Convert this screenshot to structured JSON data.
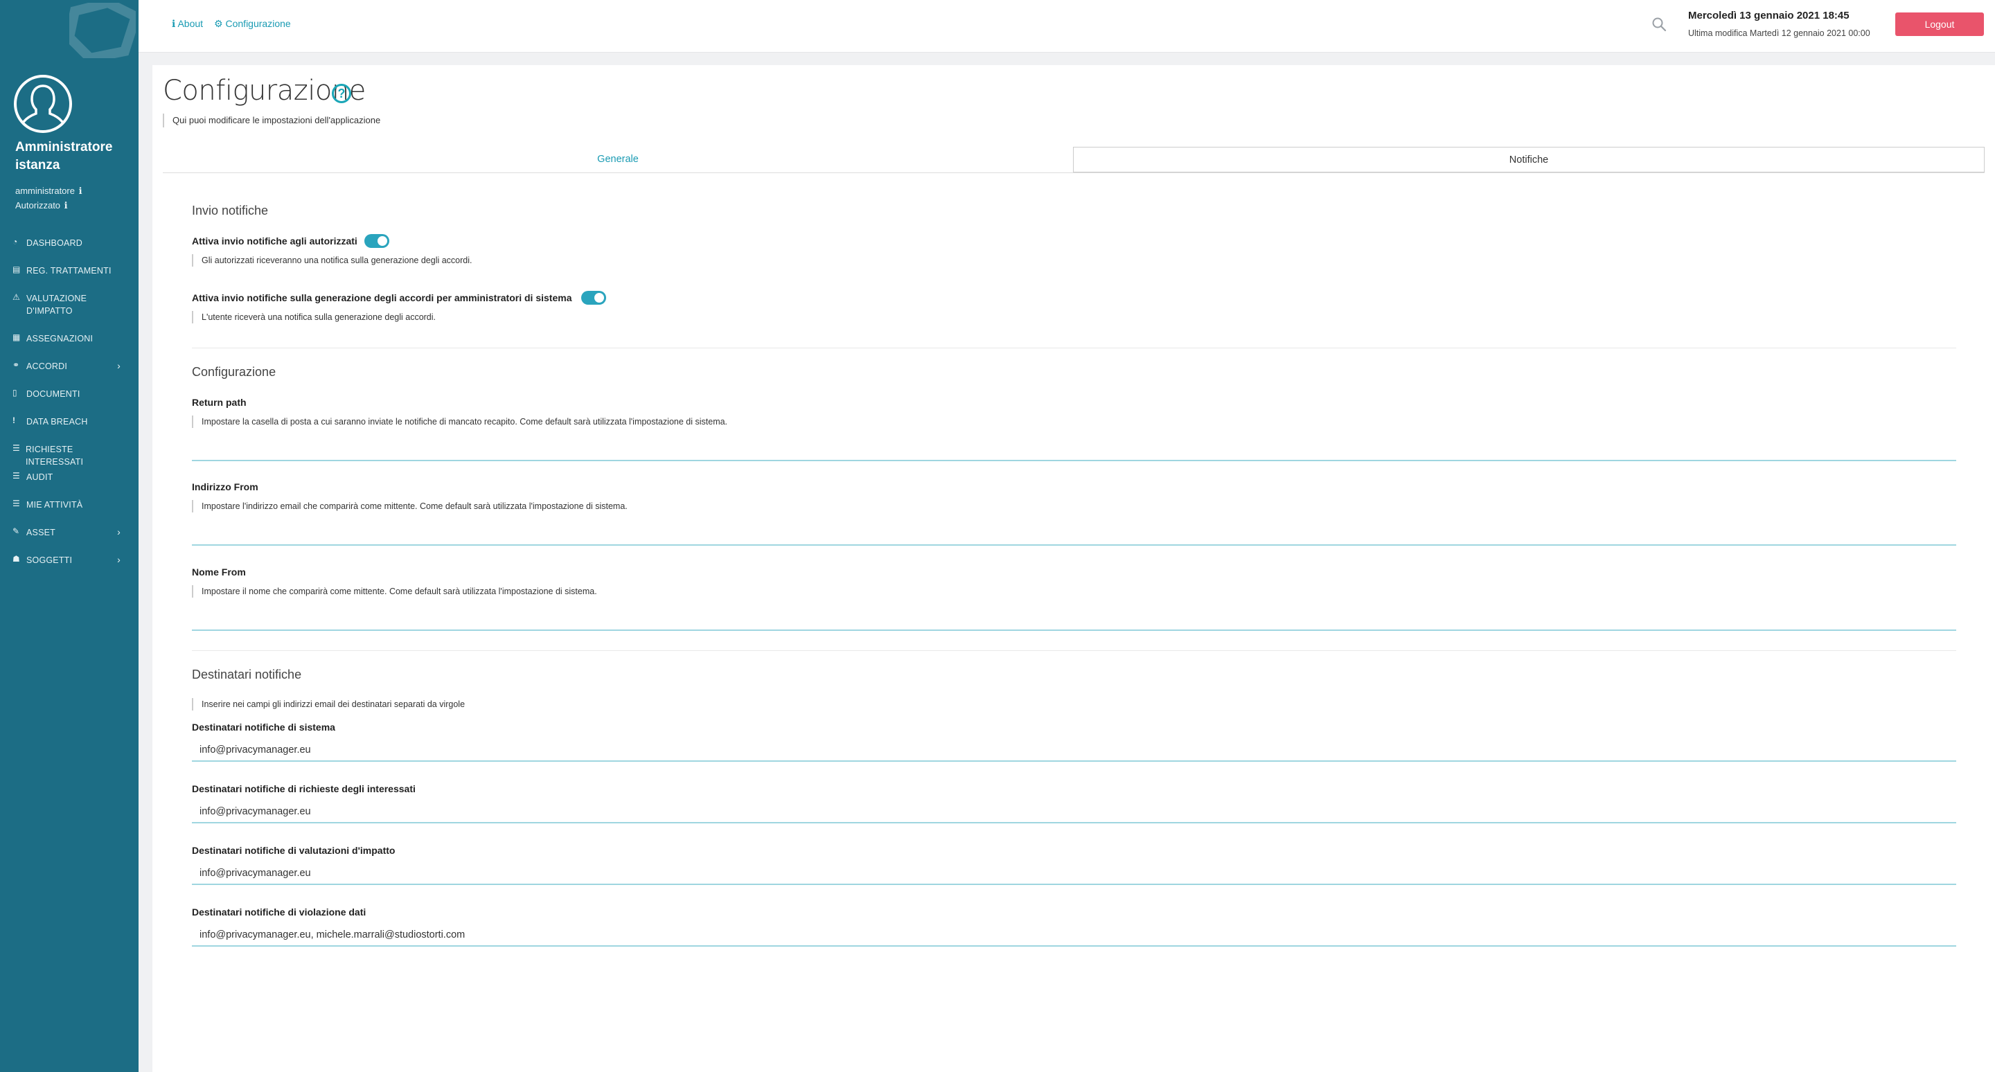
{
  "user": {
    "display_name": "Amministratore istanza",
    "role": "amministratore",
    "status": "Autorizzato",
    "info_glyph": "ℹ"
  },
  "sidebar": {
    "items": [
      {
        "label": "DASHBOARD",
        "icon": "dashboard-icon",
        "glyph": "◔"
      },
      {
        "label": "REG. TRATTAMENTI",
        "icon": "book-icon",
        "glyph": "▤"
      },
      {
        "label": "VALUTAZIONE D'IMPATTO",
        "icon": "warning-icon",
        "glyph": "⚠"
      },
      {
        "label": "ASSEGNAZIONI",
        "icon": "clipboard-icon",
        "glyph": "▦"
      },
      {
        "label": "ACCORDI",
        "icon": "handshake-icon",
        "glyph": "⚭",
        "submenu": true
      },
      {
        "label": "DOCUMENTI",
        "icon": "file-icon",
        "glyph": "▯"
      },
      {
        "label": "DATA BREACH",
        "icon": "exclamation-icon",
        "glyph": "!"
      },
      {
        "label": "RICHIESTE INTERESSATI",
        "icon": "list-icon",
        "glyph": "☰"
      },
      {
        "label": "AUDIT",
        "icon": "list-check-icon",
        "glyph": "☰"
      },
      {
        "label": "MIE ATTIVITÀ",
        "icon": "list-icon",
        "glyph": "☰"
      },
      {
        "label": "ASSET",
        "icon": "edit-icon",
        "glyph": "✎",
        "submenu": true
      },
      {
        "label": "SOGGETTI",
        "icon": "users-icon",
        "glyph": "☗",
        "submenu": true
      }
    ],
    "chevron": "›"
  },
  "topbar": {
    "about_label": "About",
    "about_glyph": "ℹ",
    "config_label": "Configurazione",
    "config_glyph": "⚙",
    "datetime": "Mercoledì 13 gennaio 2021 18:45",
    "last_modified": "Ultima modifica Martedì 12 gennaio 2021 00:00",
    "logout_label": "Logout"
  },
  "page": {
    "title": "Configurazione",
    "help_glyph": "?",
    "subtitle": "Qui puoi modificare le impostazioni dell'applicazione",
    "tabs": [
      {
        "label": "Generale",
        "active": true
      },
      {
        "label": "Notifiche",
        "active": false
      }
    ]
  },
  "invio_notifiche": {
    "title": "Invio notifiche",
    "toggle1": {
      "label": "Attiva invio notifiche agli autorizzati",
      "hint": "Gli autorizzati riceveranno una notifica sulla generazione degli accordi.",
      "on": true
    },
    "toggle2": {
      "label": "Attiva invio notifiche sulla generazione degli accordi per amministratori di sistema",
      "hint": "L'utente riceverà una notifica sulla generazione degli accordi.",
      "on": true
    }
  },
  "configurazione": {
    "title": "Configurazione",
    "return_path": {
      "label": "Return path",
      "hint": "Impostare la casella di posta a cui saranno inviate le notifiche di mancato recapito. Come default sarà utilizzata l'impostazione di sistema.",
      "value": ""
    },
    "indirizzo_from": {
      "label": "Indirizzo From",
      "hint": "Impostare l'indirizzo email che comparirà come mittente. Come default sarà utilizzata l'impostazione di sistema.",
      "value": ""
    },
    "nome_from": {
      "label": "Nome From",
      "hint": "Impostare il nome che comparirà come mittente. Come default sarà utilizzata l'impostazione di sistema.",
      "value": ""
    }
  },
  "destinatari": {
    "title": "Destinatari notifiche",
    "hint": "Inserire nei campi gli indirizzi email dei destinatari separati da virgole",
    "sistema": {
      "label": "Destinatari notifiche di sistema",
      "value": "info@privacymanager.eu"
    },
    "richieste": {
      "label": "Destinatari notifiche di richieste degli interessati",
      "value": "info@privacymanager.eu"
    },
    "valutazioni": {
      "label": "Destinatari notifiche di valutazioni d'impatto",
      "value": "info@privacymanager.eu"
    },
    "violazione": {
      "label": "Destinatari notifiche di violazione dati",
      "value": "info@privacymanager.eu, michele.marrali@studiostorti.com"
    }
  },
  "colors": {
    "sidebar": "#1c6d85",
    "accent": "#1aa6b7",
    "logout": "#e9546b",
    "toggle": "#2aa4bd"
  }
}
